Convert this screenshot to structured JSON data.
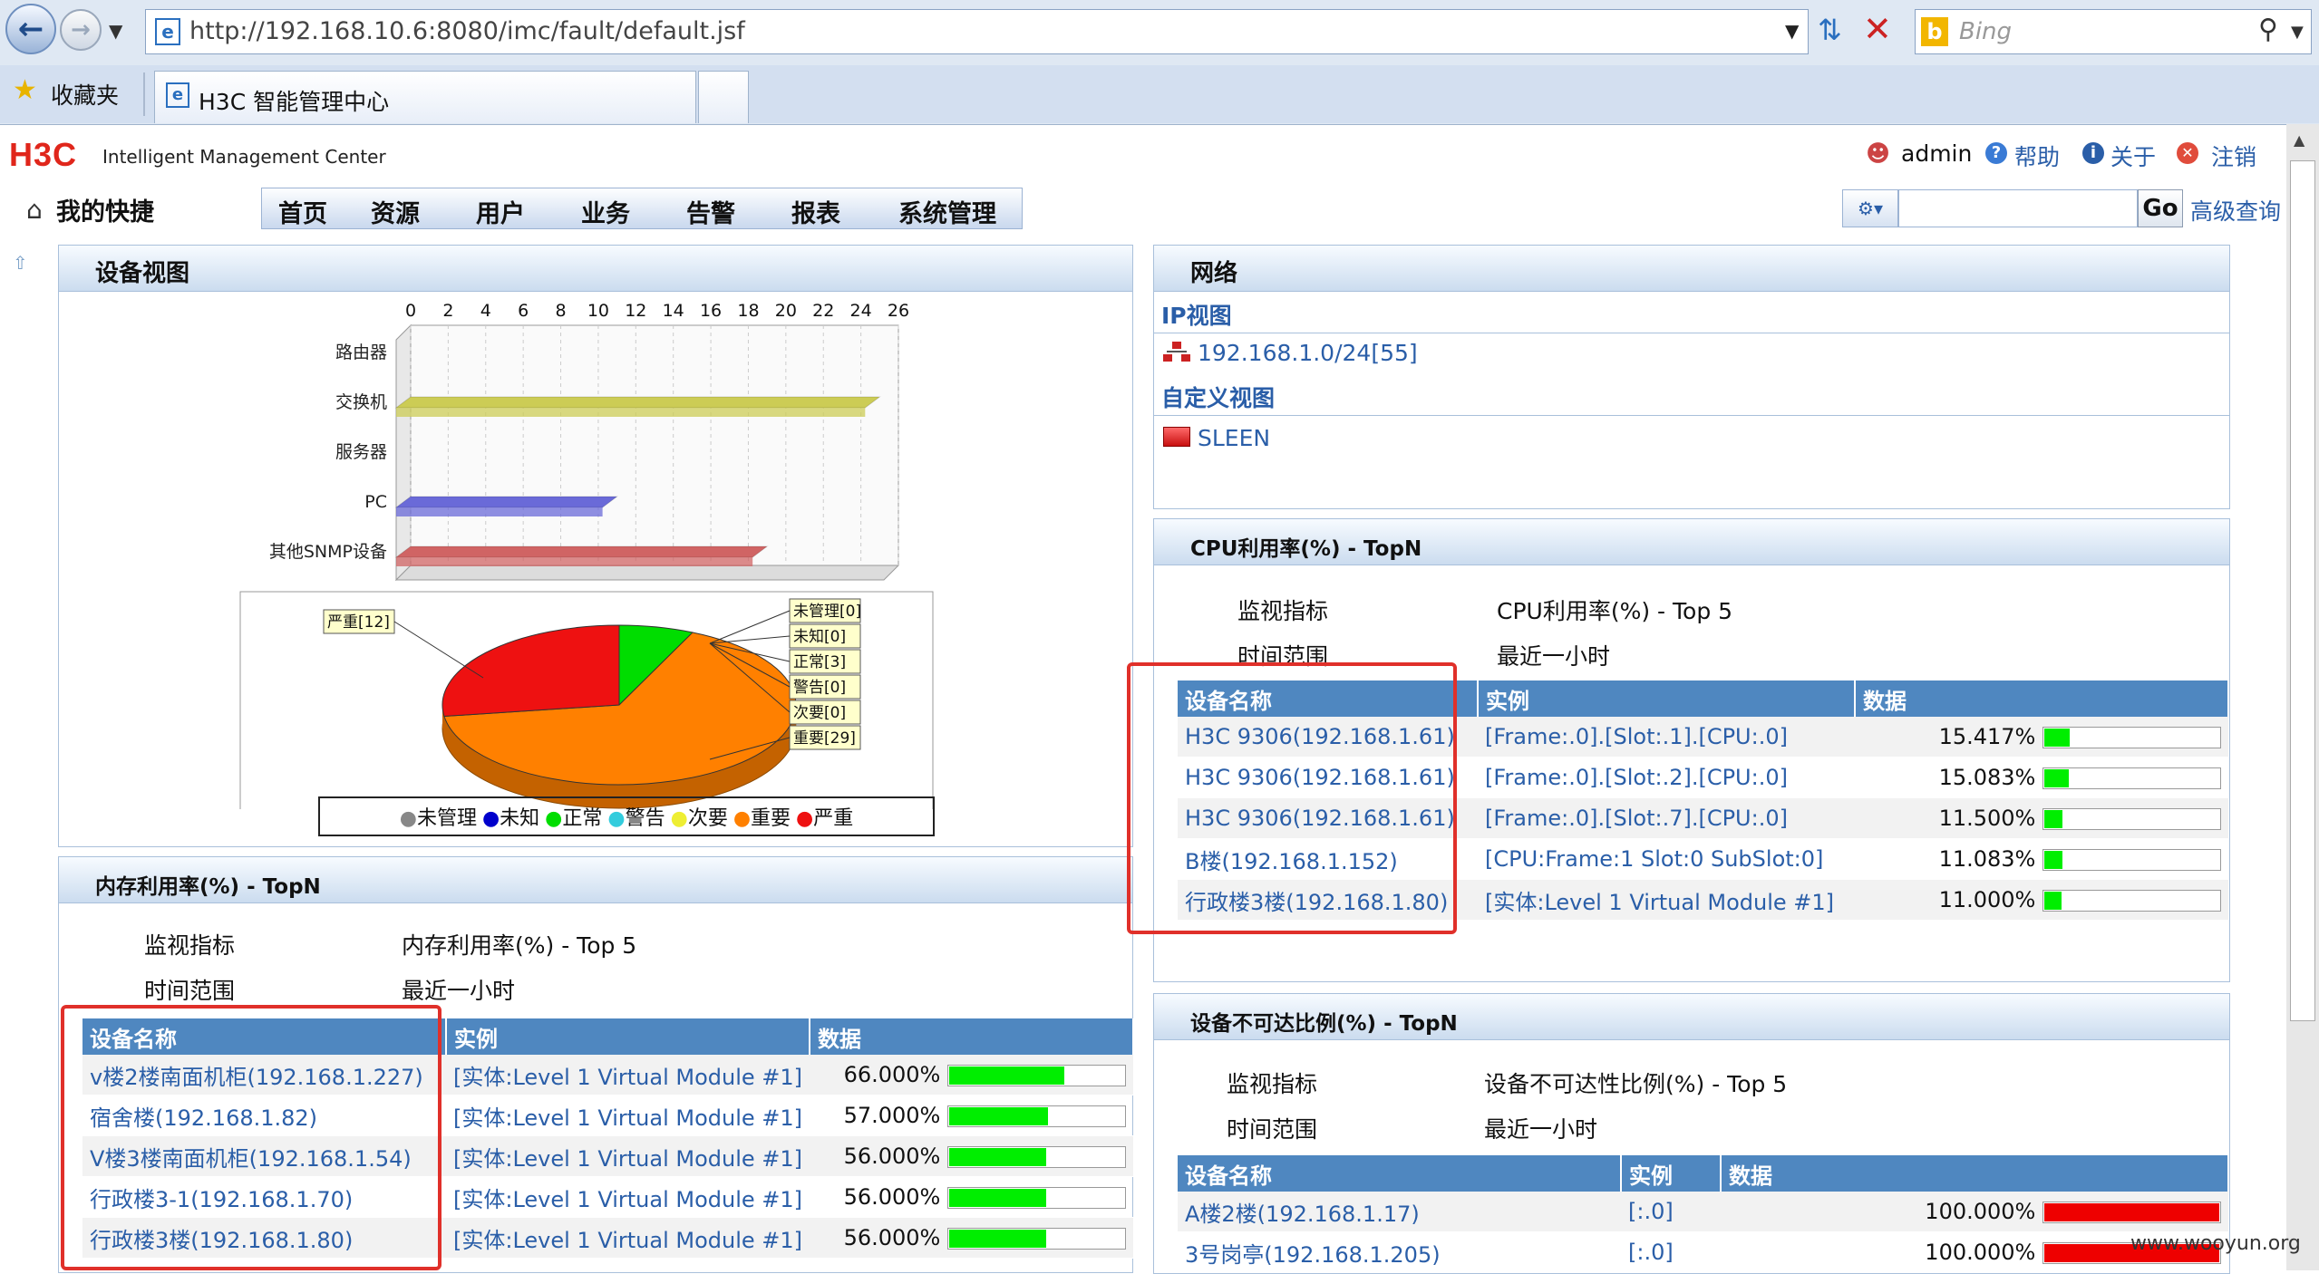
{
  "browser": {
    "url": "http://192.168.10.6:8080/imc/fault/default.jsf",
    "search_placeholder": "Bing",
    "favorites_label": "收藏夹",
    "tab_title": "H3C 智能管理中心"
  },
  "header": {
    "logo": "H3C",
    "product": "Intelligent Management Center",
    "user": "admin",
    "help": "帮助",
    "about": "关于",
    "logout": "注销",
    "go": "Go",
    "advanced_search": "高级查询",
    "quick": "我的快捷",
    "menu": [
      "首页",
      "资源",
      "用户",
      "业务",
      "告警",
      "报表",
      "系统管理"
    ]
  },
  "device_view": {
    "title": "设备视图",
    "bar_chart": {
      "type": "bar",
      "categories": [
        "路由器",
        "交换机",
        "服务器",
        "PC",
        "其他SNMP设备"
      ],
      "values": [
        0,
        25,
        0,
        11,
        19
      ],
      "colors": [
        "#cccc55",
        "#cccc55",
        "#cccc55",
        "#6a6ad8",
        "#d06464"
      ],
      "xticks": [
        0,
        2,
        4,
        6,
        8,
        10,
        12,
        14,
        16,
        18,
        20,
        22,
        24,
        26
      ],
      "xlim": [
        0,
        26
      ]
    },
    "pie_chart": {
      "type": "pie",
      "slices": [
        {
          "label": "未管理[0]",
          "value": 0,
          "color": "#888888"
        },
        {
          "label": "未知[0]",
          "value": 0,
          "color": "#0000cc"
        },
        {
          "label": "正常[3]",
          "value": 3,
          "color": "#00dd00"
        },
        {
          "label": "警告[0]",
          "value": 0,
          "color": "#33ccdd"
        },
        {
          "label": "次要[0]",
          "value": 0,
          "color": "#eeee33"
        },
        {
          "label": "重要[29]",
          "value": 29,
          "color": "#ff8000"
        },
        {
          "label": "严重[12]",
          "value": 12,
          "color": "#ee1111"
        }
      ]
    },
    "legend": [
      {
        "label": "未管理",
        "color": "#888888"
      },
      {
        "label": "未知",
        "color": "#0000cc"
      },
      {
        "label": "正常",
        "color": "#00dd00"
      },
      {
        "label": "警告",
        "color": "#33ccdd"
      },
      {
        "label": "次要",
        "color": "#eeee33"
      },
      {
        "label": "重要",
        "color": "#ff8000"
      },
      {
        "label": "严重",
        "color": "#ee1111"
      }
    ]
  },
  "network": {
    "title": "网络",
    "ip_view": "IP视图",
    "ip_item": "192.168.1.0/24[55]",
    "custom_view": "自定义视图",
    "custom_item": "SLEEN"
  },
  "cpu": {
    "title": "CPU利用率(%) - TopN",
    "metric_label": "监视指标",
    "metric_value": "CPU利用率(%) - Top 5",
    "range_label": "时间范围",
    "range_value": "最近一小时",
    "columns": [
      "设备名称",
      "实例",
      "数据"
    ],
    "rows": [
      {
        "device": "H3C 9306(192.168.1.61)",
        "instance": "[Frame:.0].[Slot:.1].[CPU:.0]",
        "value": "15.417%",
        "pct": 15.417
      },
      {
        "device": "H3C 9306(192.168.1.61)",
        "instance": "[Frame:.0].[Slot:.2].[CPU:.0]",
        "value": "15.083%",
        "pct": 15.083
      },
      {
        "device": "H3C 9306(192.168.1.61)",
        "instance": "[Frame:.0].[Slot:.7].[CPU:.0]",
        "value": "11.500%",
        "pct": 11.5
      },
      {
        "device": "B楼(192.168.1.152)",
        "instance": "[CPU:Frame:1 Slot:0 SubSlot:0]",
        "value": "11.083%",
        "pct": 11.083
      },
      {
        "device": "行政楼3楼(192.168.1.80)",
        "instance": "[实体:Level 1 Virtual Module #1]",
        "value": "11.000%",
        "pct": 11.0
      }
    ]
  },
  "memory": {
    "title": "内存利用率(%) - TopN",
    "metric_label": "监视指标",
    "metric_value": "内存利用率(%) - Top 5",
    "range_label": "时间范围",
    "range_value": "最近一小时",
    "columns": [
      "设备名称",
      "实例",
      "数据"
    ],
    "rows": [
      {
        "device": "v楼2楼南面机柜(192.168.1.227)",
        "instance": "[实体:Level 1 Virtual Module #1]",
        "value": "66.000%",
        "pct": 66
      },
      {
        "device": "宿舍楼(192.168.1.82)",
        "instance": "[实体:Level 1 Virtual Module #1]",
        "value": "57.000%",
        "pct": 57
      },
      {
        "device": "V楼3楼南面机柜(192.168.1.54)",
        "instance": "[实体:Level 1 Virtual Module #1]",
        "value": "56.000%",
        "pct": 56
      },
      {
        "device": "行政楼3-1(192.168.1.70)",
        "instance": "[实体:Level 1 Virtual Module #1]",
        "value": "56.000%",
        "pct": 56
      },
      {
        "device": "行政楼3楼(192.168.1.80)",
        "instance": "[实体:Level 1 Virtual Module #1]",
        "value": "56.000%",
        "pct": 56
      }
    ]
  },
  "unreachable": {
    "title": "设备不可达比例(%) - TopN",
    "metric_label": "监视指标",
    "metric_value": "设备不可达性比例(%) - Top 5",
    "range_label": "时间范围",
    "range_value": "最近一小时",
    "columns": [
      "设备名称",
      "实例",
      "数据"
    ],
    "rows": [
      {
        "device": "A楼2楼(192.168.1.17)",
        "instance": "[:.0]",
        "value": "100.000%",
        "pct": 100
      },
      {
        "device": "3号岗亭(192.168.1.205)",
        "instance": "[:.0]",
        "value": "100.000%",
        "pct": 100
      }
    ]
  },
  "watermark": "www.wooyun.org",
  "colors": {
    "accent": "#2a5ea8",
    "header_blue": "#4f87c0",
    "highlight_red": "#e0302a",
    "bar_green": "#00ee00",
    "bar_red": "#ee0000"
  }
}
